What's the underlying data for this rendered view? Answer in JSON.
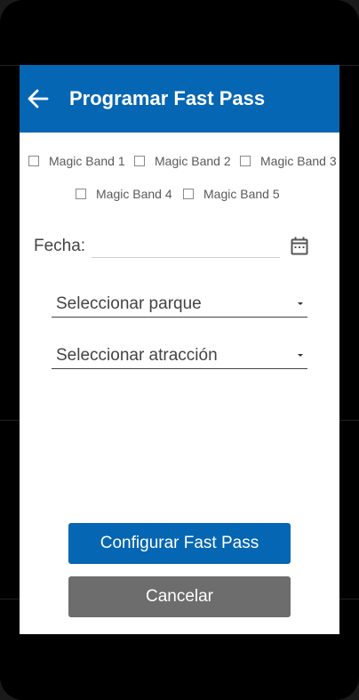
{
  "appbar": {
    "title": "Programar Fast Pass",
    "back_icon": "arrow-left-icon",
    "color": "#0566b3"
  },
  "magic_bands": [
    {
      "label": "Magic Band 1",
      "checked": false
    },
    {
      "label": "Magic Band 2",
      "checked": false
    },
    {
      "label": "Magic Band 3",
      "checked": false
    },
    {
      "label": "Magic Band 4",
      "checked": false
    },
    {
      "label": "Magic Band 5",
      "checked": false
    }
  ],
  "fecha": {
    "label": "Fecha:",
    "value": "",
    "icon": "calendar-icon"
  },
  "park_select": {
    "selected": "Seleccionar parque"
  },
  "attraction_select": {
    "selected": "Seleccionar atracción"
  },
  "buttons": {
    "configure": {
      "label": "Configurar Fast Pass",
      "color": "#0566b3"
    },
    "cancel": {
      "label": "Cancelar",
      "color": "#6d6d6d"
    }
  }
}
